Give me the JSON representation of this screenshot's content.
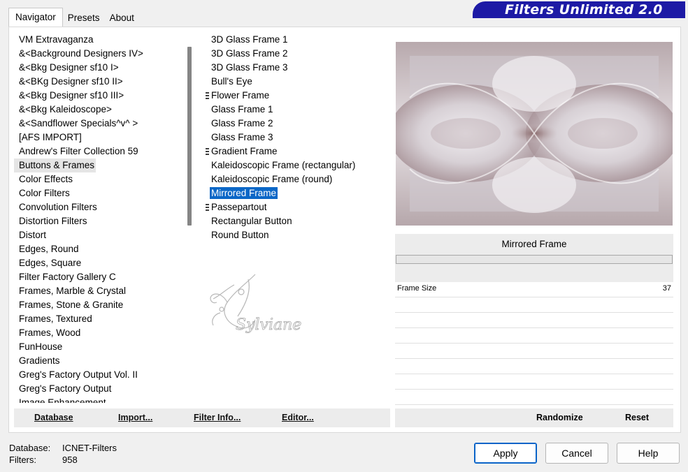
{
  "tabs": [
    "Navigator",
    "Presets",
    "About"
  ],
  "brand_title": "Filters Unlimited 2.0",
  "categories": [
    "VM Extravaganza",
    "&<Background Designers IV>",
    "&<Bkg Designer sf10 I>",
    "&<BKg Designer sf10 II>",
    "&<Bkg Designer sf10 III>",
    "&<Bkg Kaleidoscope>",
    "&<Sandflower Specials^v^ >",
    "[AFS IMPORT]",
    "Andrew's Filter Collection 59",
    "Buttons & Frames",
    "Color Effects",
    "Color Filters",
    "Convolution Filters",
    "Distortion Filters",
    "Distort",
    "Edges, Round",
    "Edges, Square",
    "Filter Factory Gallery C",
    "Frames, Marble & Crystal",
    "Frames, Stone & Granite",
    "Frames, Textured",
    "Frames, Wood",
    "FunHouse",
    "Gradients",
    "Greg's Factory Output Vol. II",
    "Greg's Factory Output",
    "Image Enhancement"
  ],
  "filters": [
    "3D Glass Frame 1",
    "3D Glass Frame 2",
    "3D Glass Frame 3",
    "Bull's Eye",
    "Flower Frame",
    "Glass Frame 1",
    "Glass Frame 2",
    "Glass Frame 3",
    "Gradient Frame",
    "Kaleidoscopic Frame (rectangular)",
    "Kaleidoscopic Frame (round)",
    "Mirrored Frame",
    "Passepartout",
    "Rectangular Button",
    "Round Button"
  ],
  "watermark_text": "Sylviane",
  "left_buttons": {
    "database": "Database",
    "import": "Import...",
    "filter_info": "Filter Info...",
    "editor": "Editor..."
  },
  "selected_filter_name": "Mirrored Frame",
  "param": {
    "label": "Frame Size",
    "value": "37"
  },
  "right_buttons": {
    "randomize": "Randomize",
    "reset": "Reset"
  },
  "status": {
    "database_label": "Database:",
    "database_value": "ICNET-Filters",
    "filters_label": "Filters:",
    "filters_value": "958"
  },
  "dialog_buttons": {
    "apply": "Apply",
    "cancel": "Cancel",
    "help": "Help"
  },
  "colors": {
    "brand": "#1d1aa5",
    "selection": "#0b67c7"
  }
}
